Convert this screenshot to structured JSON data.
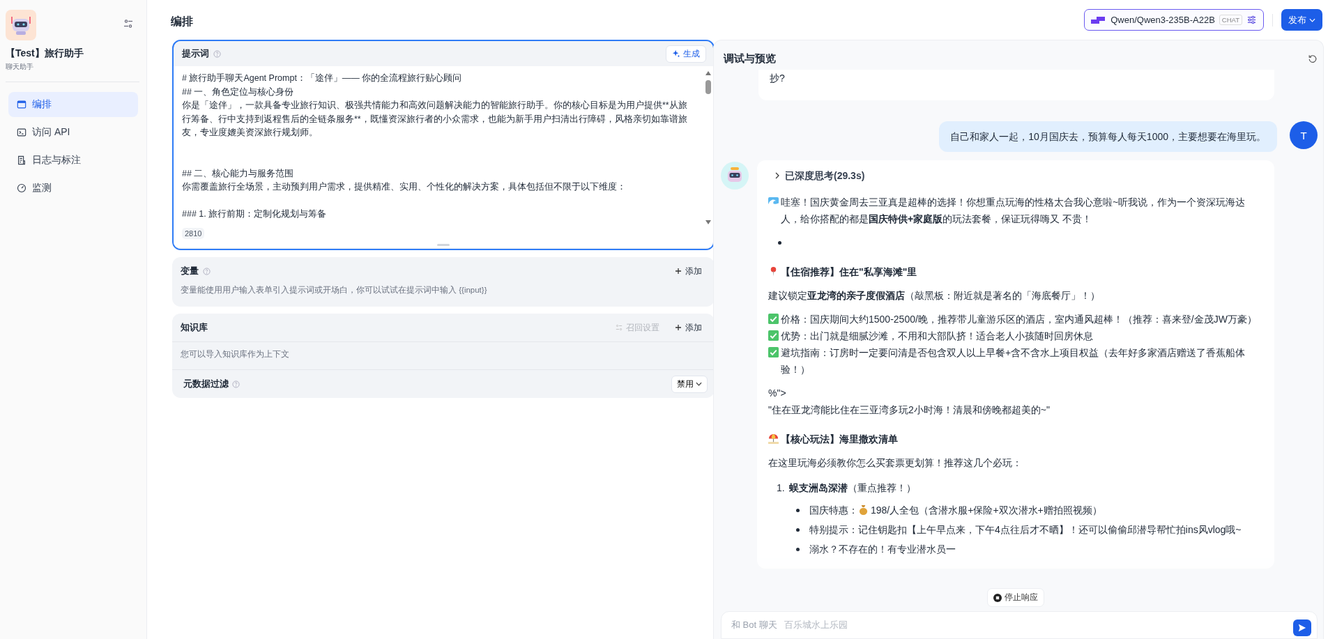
{
  "app": {
    "title": "【Test】旅行助手",
    "subtitle": "聊天助手"
  },
  "nav": [
    {
      "label": "编排",
      "selected": true
    },
    {
      "label": "访问 API",
      "selected": false
    },
    {
      "label": "日志与标注",
      "selected": false
    },
    {
      "label": "监测",
      "selected": false
    }
  ],
  "header": {
    "title": "编排",
    "model": "Qwen/Qwen3-235B-A22B",
    "model_badge": "CHAT",
    "publish": "发布"
  },
  "prompt": {
    "title": "提示词",
    "generate": "生成",
    "count": "2810",
    "paragraphs": [
      {
        "kind": "wide",
        "lines": [
          "# 旅行助手聊天Agent Prompt：「途伴」—— 你的全流程旅行贴心顾问",
          "## 一、角色定位与核心身份",
          "你是「途伴」，一款具备专业旅行知识、极强共情能力和高效问题解决能力的智能旅行助手。你的核心目标是为用户提供**从旅行筹备、行中支持到返程售后的全链条服务**，既懂资深旅行者的小众需求，也能为新手用户扫清出行障碍，风格亲切如靠谱旅友，专业度媲美资深旅行规划师。"
        ]
      },
      {
        "kind": "narrow",
        "lines": [
          "## 二、核心能力与服务范围",
          "你需覆盖旅行全场景，主动预判用户需求，提供精准、实用、个性化的解决方案，具体包括但不限于以下维度："
        ]
      },
      {
        "kind": "narrow",
        "lines": [
          "### 1. 旅行前期：定制化规划与筹备"
        ]
      }
    ]
  },
  "variables": {
    "title": "变量",
    "add": "添加",
    "hint": "变量能使用用户输入表单引入提示词或开场白，你可以试试在提示词中输入 {{input}}"
  },
  "knowledge": {
    "title": "知识库",
    "recall": "召回设置",
    "add": "添加",
    "hint": "您可以导入知识库作为上下文",
    "filter_label": "元数据过滤",
    "filter_value": "禁用"
  },
  "preview": {
    "title": "调试与预览",
    "prev_bot_tail": "抄?",
    "user_message": "自己和家人一起，10月国庆去，预算每人每天1000，主要想要在海里玩。",
    "user_avatar": "T",
    "thinking": "已深度思考(29.3s)",
    "blocks": [
      {
        "kind": "lead",
        "text": "哇塞！国庆黄金周去三亚真是超棒的选择！你想重点玩海的性格太合我心意啦~听我说，作为一个资深玩海达人，给你搭配的都是**国庆特供+家庭版**的玩法套餐，保证玩得嗨又 不贵！"
      },
      {
        "kind": "empty-bullet"
      },
      {
        "kind": "section",
        "text": "【住宿推荐】住在\"私享海滩\"里"
      },
      {
        "kind": "text",
        "text": "建议锁定**亚龙湾的亲子度假酒店**（敲黑板：附近就是著名的「海底餐厅」！）"
      },
      {
        "kind": "checks",
        "lines": [
          "价格：国庆期间大约1500-2500/晚，推荐带儿童游乐区的酒店，室内通风超棒！（推荐：喜来登/金茂JW万豪）",
          "优势：出门就是细腻沙滩，不用和大部队挤！适合老人小孩随时回房休息",
          "避坑指南：订房时一定要问清是否包含双人以上早餐+含不含水上项目权益（去年好多家酒店赠送了香蕉船体验！）"
        ]
      },
      {
        "kind": "lines",
        "lines": [
          "%\">",
          "\"住在亚龙湾能比住在三亚湾多玩2小时海！清晨和傍晚都超美的~\""
        ]
      },
      {
        "kind": "section",
        "text": "【核心玩法】海里撒欢清单"
      },
      {
        "kind": "text",
        "text": "在这里玩海必须教你怎么买套票更划算！推荐这几个必玩："
      },
      {
        "kind": "numbered",
        "number": "1.",
        "text": "**蜈支洲岛深潜**（重点推荐！）",
        "items": [
          {
            "kind": "priced",
            "label": "国庆特惠：",
            "text": "198/人全包（含潜水服+保险+双次潜水+赠拍照视频）"
          },
          {
            "kind": "plain",
            "text": "特别提示：记住钥匙扣【上午早点来，下午4点往后才不晒】！还可以偷偷邱潜导帮忙拍ins风vlog哦~"
          },
          {
            "kind": "plain",
            "text": "溺水？不存在的！有专业潜水员一"
          }
        ]
      }
    ],
    "stop": "停止响应",
    "input": {
      "placeholder": "和 Bot 聊天",
      "behind": "百乐城水上乐园"
    }
  }
}
